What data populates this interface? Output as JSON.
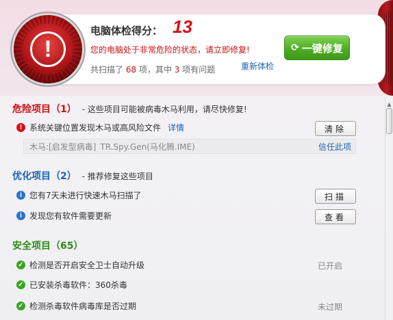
{
  "header": {
    "score_label": "电脑体检得分：",
    "score_value": "13",
    "warning": "您的电脑处于非常危险的状态，请立即修复!",
    "scan_prefix": "共扫描了",
    "scan_total": "68",
    "scan_mid": "项，其中",
    "scan_issues": "3",
    "scan_suffix": "项有问题",
    "rescan_label": "重新体检",
    "fix_all_label": "一键修复",
    "alert_icon": "exclamation-icon"
  },
  "danger": {
    "title": "危险项目（1）",
    "desc": "- 这些项目可能被病毒木马利用，请尽快修复!",
    "items": [
      {
        "text": "系统关键位置发现木马或高风险文件",
        "link": "详情",
        "button": "清除",
        "detail_prefix": "木马:[启发型病毒]",
        "detail_name": "TR.Spy.Gen(马化腾.IME)",
        "detail_link": "信任此项"
      }
    ]
  },
  "optimize": {
    "title": "优化项目（2）",
    "desc": "- 推荐修复这些项目",
    "items": [
      {
        "text": "您有7天未进行快速木马扫描了",
        "button": "扫描"
      },
      {
        "text": "发现您有软件需要更新",
        "button": "查看"
      }
    ]
  },
  "safe": {
    "title": "安全项目（65）",
    "items": [
      {
        "text": "检测是否开启安全卫士自动升级",
        "status": "已开启"
      },
      {
        "text": "已安装杀毒软件：360杀毒",
        "status": ""
      },
      {
        "text": "检测杀毒软件病毒库是否过期",
        "status": "未过期"
      }
    ]
  },
  "colors": {
    "danger": "#cc1111",
    "optimize": "#1a62b5",
    "safe": "#2c8a17",
    "fix_button": "#4fac24"
  }
}
